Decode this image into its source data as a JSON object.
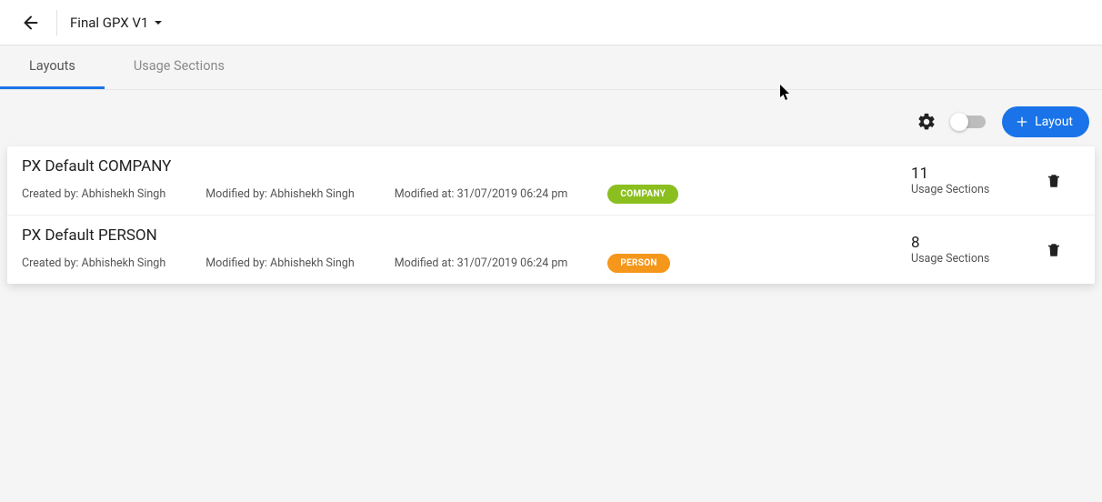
{
  "header": {
    "title": "Final GPX V1"
  },
  "tabs": [
    {
      "label": "Layouts",
      "active": true
    },
    {
      "label": "Usage Sections",
      "active": false
    }
  ],
  "toolbar": {
    "layout_button": "Layout"
  },
  "labels": {
    "created_by_prefix": "Created by: ",
    "modified_by_prefix": "Modified by: ",
    "modified_at_prefix": "Modified at: ",
    "usage_sections": "Usage Sections"
  },
  "rows": [
    {
      "title": "PX Default COMPANY",
      "created_by": "Abhishekh Singh",
      "modified_by": "Abhishekh Singh",
      "modified_at": "31/07/2019 06:24 pm",
      "badge": {
        "text": "COMPANY",
        "color": "#8bbf1f"
      },
      "usage_count": "11"
    },
    {
      "title": "PX Default PERSON",
      "created_by": "Abhishekh Singh",
      "modified_by": "Abhishekh Singh",
      "modified_at": "31/07/2019 06:24 pm",
      "badge": {
        "text": "PERSON",
        "color": "#f5971a"
      },
      "usage_count": "8"
    }
  ]
}
